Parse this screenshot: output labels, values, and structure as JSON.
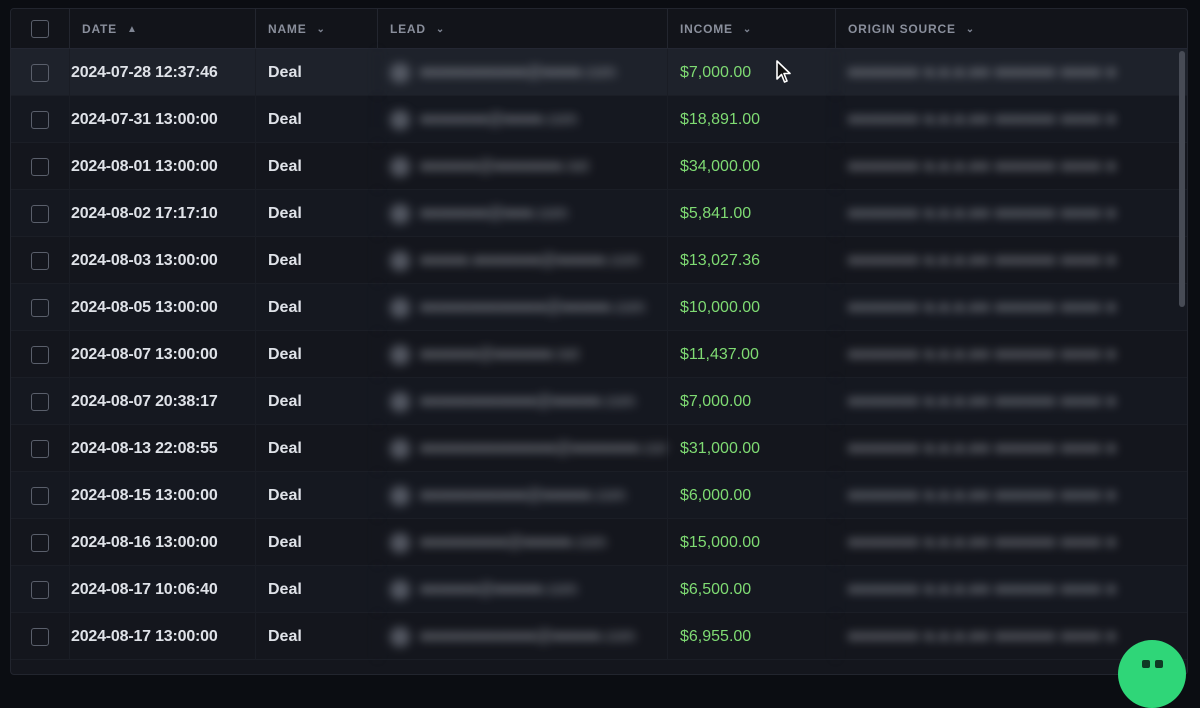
{
  "columns": {
    "date": "DATE",
    "name": "NAME",
    "lead": "LEAD",
    "income": "INCOME",
    "origin": "ORIGIN SOURCE"
  },
  "sort_icons": {
    "date": "chevron-up-icon",
    "others": "chevron-down-icon"
  },
  "rows": [
    {
      "date": "2024-07-28 12:37:46",
      "name": "Deal",
      "lead": "●●●●●●●●●●●@●●●●.com",
      "income": "$7,000.00",
      "origin": "●●●●●●● ●.●.●.●● ●●●●●● ●●●● ●"
    },
    {
      "date": "2024-07-31 13:00:00",
      "name": "Deal",
      "lead": "●●●●●●●@●●●●.com",
      "income": "$18,891.00",
      "origin": "●●●●●●● ●.●.●.●● ●●●●●● ●●●● ●"
    },
    {
      "date": "2024-08-01 13:00:00",
      "name": "Deal",
      "lead": "●●●●●●@●●●●●●●.net",
      "income": "$34,000.00",
      "origin": "●●●●●●● ●.●.●.●● ●●●●●● ●●●● ●"
    },
    {
      "date": "2024-08-02 17:17:10",
      "name": "Deal",
      "lead": "●●●●●●●@●●●.com",
      "income": "$5,841.00",
      "origin": "●●●●●●● ●.●.●.●● ●●●●●● ●●●● ●"
    },
    {
      "date": "2024-08-03 13:00:00",
      "name": "Deal",
      "lead": "●●●●●.●●●●●●●@●●●●●.com",
      "income": "$13,027.36",
      "origin": "●●●●●●● ●.●.●.●● ●●●●●● ●●●● ●"
    },
    {
      "date": "2024-08-05 13:00:00",
      "name": "Deal",
      "lead": "●●●●●●●●●●●●●@●●●●●.com",
      "income": "$10,000.00",
      "origin": "●●●●●●● ●.●.●.●● ●●●●●● ●●●● ●"
    },
    {
      "date": "2024-08-07 13:00:00",
      "name": "Deal",
      "lead": "●●●●●●@●●●●●●.net",
      "income": "$11,437.00",
      "origin": "●●●●●●● ●.●.●.●● ●●●●●● ●●●● ●"
    },
    {
      "date": "2024-08-07 20:38:17",
      "name": "Deal",
      "lead": "●●●●●●●●●●●●@●●●●●.com",
      "income": "$7,000.00",
      "origin": "●●●●●●● ●.●.●.●● ●●●●●● ●●●● ●"
    },
    {
      "date": "2024-08-13 22:08:55",
      "name": "Deal",
      "lead": "●●●●●●●●●●●●●●@●●●●●●●.com",
      "income": "$31,000.00",
      "origin": "●●●●●●● ●.●.●.●● ●●●●●● ●●●● ●"
    },
    {
      "date": "2024-08-15 13:00:00",
      "name": "Deal",
      "lead": "●●●●●●●●●●●@●●●●●.com",
      "income": "$6,000.00",
      "origin": "●●●●●●● ●.●.●.●● ●●●●●● ●●●● ●"
    },
    {
      "date": "2024-08-16 13:00:00",
      "name": "Deal",
      "lead": "●●●●●●●●●@●●●●●.com",
      "income": "$15,000.00",
      "origin": "●●●●●●● ●.●.●.●● ●●●●●● ●●●● ●"
    },
    {
      "date": "2024-08-17 10:06:40",
      "name": "Deal",
      "lead": "●●●●●●@●●●●●.com",
      "income": "$6,500.00",
      "origin": "●●●●●●● ●.●.●.●● ●●●●●● ●●●● ●"
    },
    {
      "date": "2024-08-17 13:00:00",
      "name": "Deal",
      "lead": "●●●●●●●●●●●●@●●●●●.com",
      "income": "$6,955.00",
      "origin": "●●●●●●● ●.●.●.●● ●●●●●● ●●●● ●"
    }
  ],
  "colors": {
    "income_green": "#7fdb73",
    "accent_green": "#2fd678",
    "background": "#14161d"
  }
}
